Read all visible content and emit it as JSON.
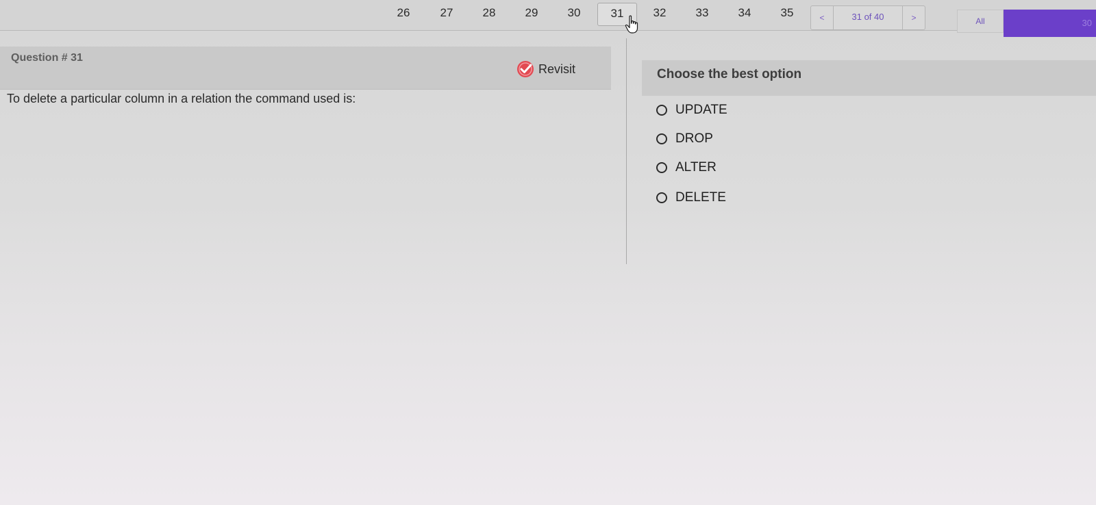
{
  "nav": {
    "question_numbers": [
      "26",
      "27",
      "28",
      "29",
      "30",
      "31",
      "32",
      "33",
      "34",
      "35"
    ],
    "active_question": "31",
    "pager": {
      "prev_label": "<",
      "count_label": "31 of 40",
      "next_label": ">"
    },
    "filter_label": "All",
    "timer_label": "30"
  },
  "question": {
    "title": "Question # 31",
    "revisit_label": "Revisit",
    "text": "To delete a particular column in a relation the command used is:"
  },
  "answers": {
    "heading": "Choose the best option",
    "options": [
      {
        "label": "UPDATE"
      },
      {
        "label": "DROP"
      },
      {
        "label": "ALTER"
      },
      {
        "label": "DELETE"
      }
    ]
  },
  "colors": {
    "accent": "#6b3fc9",
    "revisit_icon": "#e24a52"
  }
}
